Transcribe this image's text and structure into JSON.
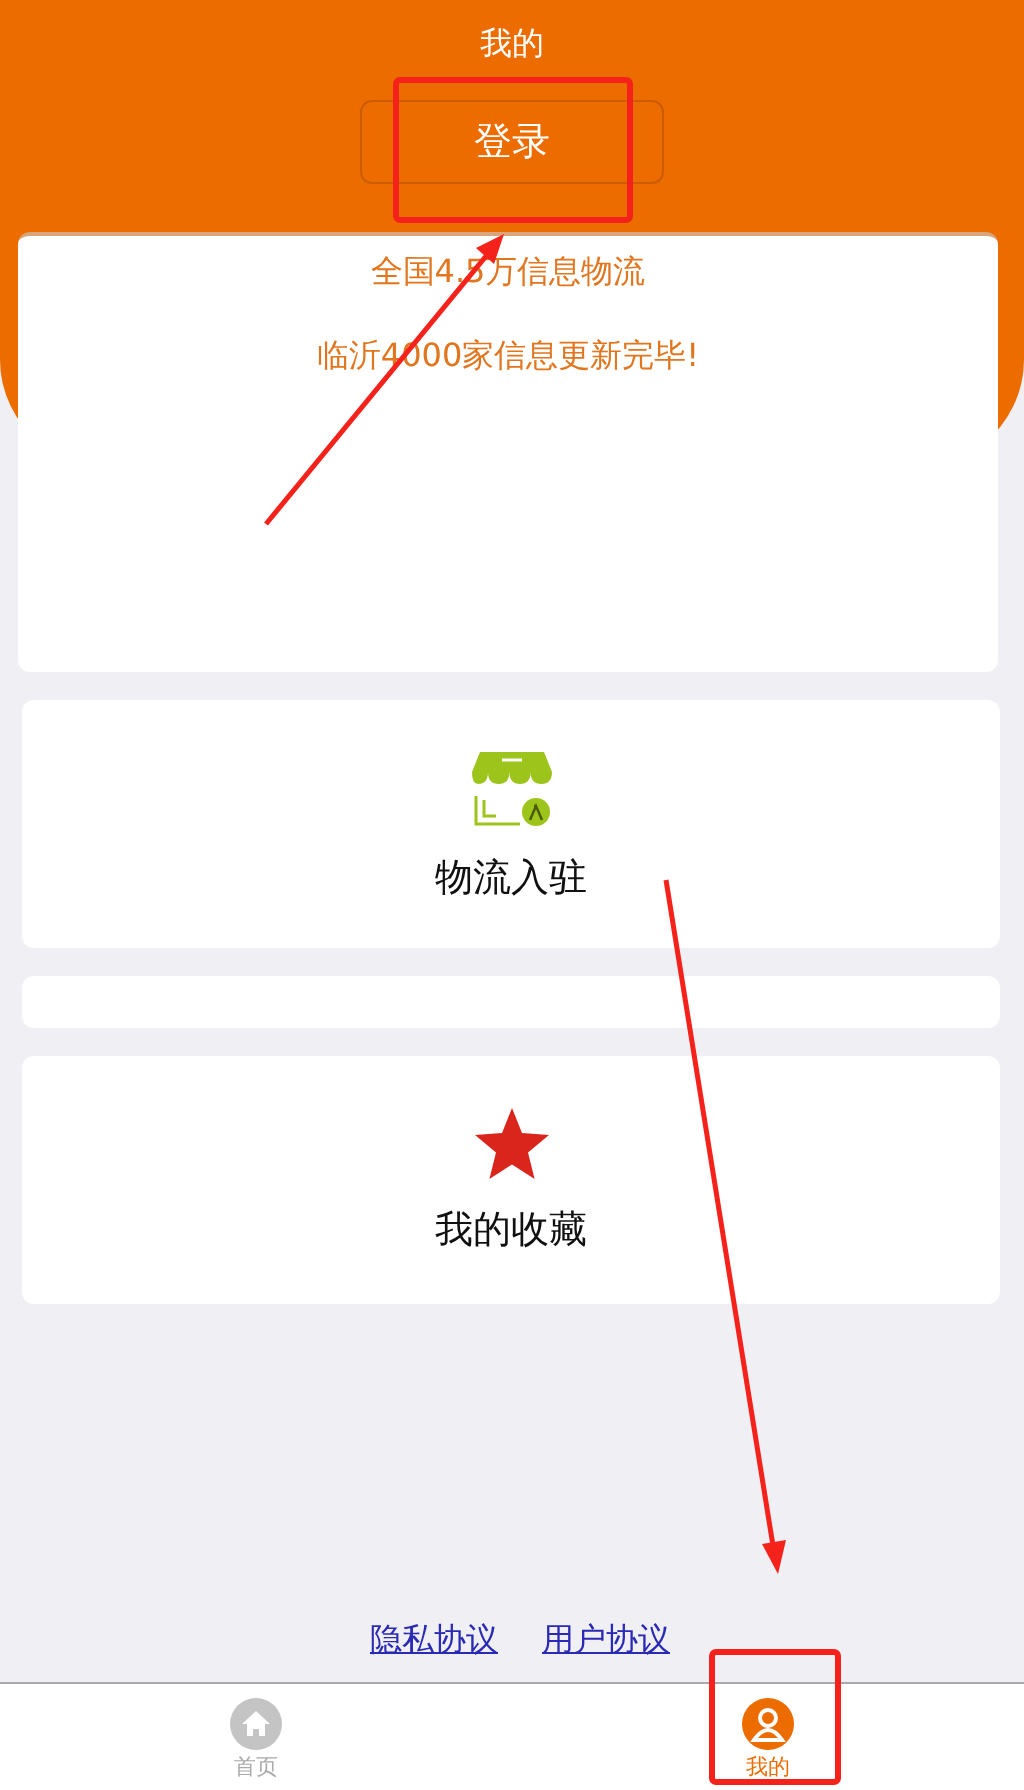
{
  "header": {
    "title": "我的",
    "login_button": "登录"
  },
  "notices": [
    "全国4.5万信息物流",
    "临沂4000家信息更新完毕!"
  ],
  "cards": [
    {
      "kind": "shop",
      "label": "物流入驻"
    },
    {
      "kind": "blank"
    },
    {
      "kind": "star",
      "label": "我的收藏"
    }
  ],
  "links": [
    "隐私协议",
    "用户协议"
  ],
  "tabs": [
    {
      "label": "首页",
      "selected": false
    },
    {
      "label": "我的",
      "selected": true
    }
  ]
}
